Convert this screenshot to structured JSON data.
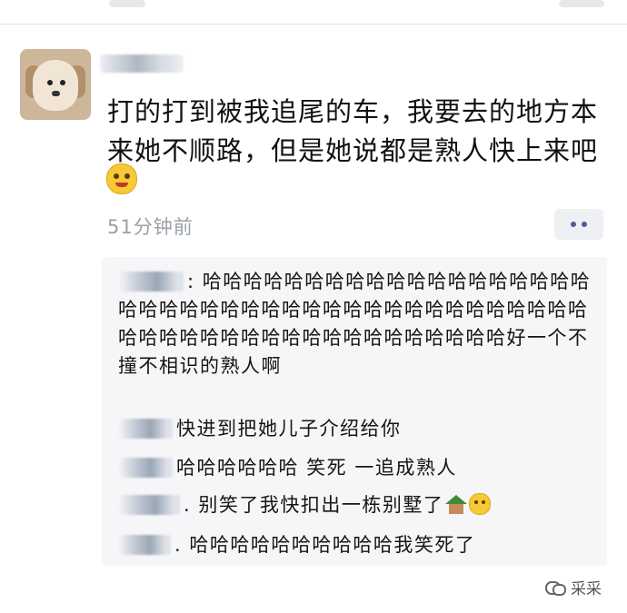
{
  "post": {
    "text": "打的打到被我追尾的车，我要去的地方本来她不顺路，但是她说都是熟人快上来吧",
    "emoji": "smiling-face-emoji",
    "time": "51分钟前"
  },
  "comments": [
    {
      "text": ": 哈哈哈哈哈哈哈哈哈哈哈哈哈哈哈哈哈哈哈哈哈哈哈哈哈哈哈哈哈哈哈哈哈哈哈哈哈哈哈哈哈哈哈哈哈哈哈哈哈哈哈哈哈哈哈哈哈哈哈哈哈好一个不撞不相识的熟人啊"
    },
    {
      "text": "快进到把她儿子介绍给你"
    },
    {
      "text": "哈哈哈哈哈哈 笑死 一追成熟人"
    },
    {
      "text": ". 别笑了我快扣出一栋别墅了"
    },
    {
      "text": ". 哈哈哈哈哈哈哈哈哈哈我笑死了"
    }
  ],
  "watermark": {
    "text": "采采"
  }
}
